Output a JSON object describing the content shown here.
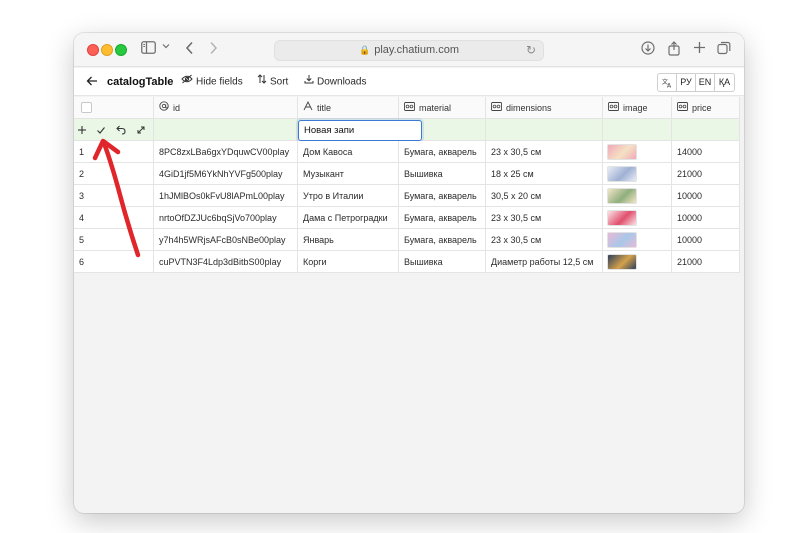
{
  "browser": {
    "url": "play.chatium.com",
    "lock_glyph": "🔒"
  },
  "toolbar": {
    "table_name": "catalogTable",
    "hide_fields": "Hide fields",
    "sort": "Sort",
    "downloads": "Downloads",
    "languages": [
      "РУ",
      "EN",
      "ҚА"
    ]
  },
  "table": {
    "columns": [
      {
        "label": "id",
        "icon": "at-icon"
      },
      {
        "label": "title",
        "icon": "text-type-icon"
      },
      {
        "label": "material",
        "icon": "field-icon"
      },
      {
        "label": "dimensions",
        "icon": "field-icon"
      },
      {
        "label": "image",
        "icon": "field-icon"
      },
      {
        "label": "price",
        "icon": "field-icon"
      }
    ],
    "new_row": {
      "title_value": "Новая запи"
    },
    "rows": [
      {
        "num": "1",
        "id": "8PC8zxLBa6gxYDquwCV00play",
        "title": "Дом Кавоса",
        "material": "Бумага, акварель",
        "dimensions": "23 х 30,5 см",
        "price": "14000",
        "thumb_colors": [
          "#f2a8b8",
          "#f4e2c4"
        ]
      },
      {
        "num": "2",
        "id": "4GiD1jf5M6YkNhYVFg500play",
        "title": "Музыкант",
        "material": "Вышивка",
        "dimensions": "18 х 25 см",
        "price": "21000",
        "thumb_colors": [
          "#e9eef6",
          "#9fb0d4"
        ]
      },
      {
        "num": "3",
        "id": "1hJMlBOs0kFvU8lAPmL00play",
        "title": "Утро в Италии",
        "material": "Бумага, акварель",
        "dimensions": "30,5 х 20 см",
        "price": "10000",
        "thumb_colors": [
          "#f3e6c8",
          "#8fae7d"
        ]
      },
      {
        "num": "4",
        "id": "nrtoOfDZJUc6bqSjVo700play",
        "title": "Дама с Петроградки",
        "material": "Бумага, акварель",
        "dimensions": "23 х 30,5 см",
        "price": "10000",
        "thumb_colors": [
          "#fbe3e8",
          "#e0506d"
        ]
      },
      {
        "num": "5",
        "id": "y7h4h5WRjsAFcB0sNBe00play",
        "title": "Январь",
        "material": "Бумага, акварель",
        "dimensions": "23 х 30,5 см",
        "price": "10000",
        "thumb_colors": [
          "#e8b8d8",
          "#a8c8e8"
        ]
      },
      {
        "num": "6",
        "id": "cuPVTN3F4Ldp3dBitbS00play",
        "title": "Корги",
        "material": "Вышивка",
        "dimensions": "Диаметр работы 12,5 см",
        "price": "21000",
        "thumb_colors": [
          "#2e3f5c",
          "#d4a24a"
        ]
      }
    ]
  },
  "annotation": {
    "arrow_color": "#e0262a"
  },
  "colors": {
    "new_row_bg": "#eaf7e6",
    "focus_border": "#3a79d4"
  }
}
